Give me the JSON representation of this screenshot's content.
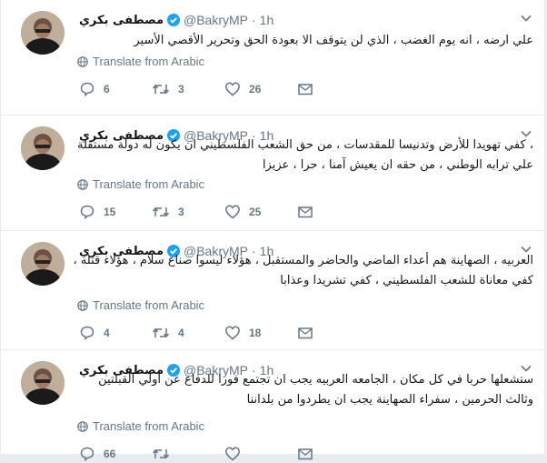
{
  "tweets": [
    {
      "display_name": "مصطفى بكري",
      "handle": "@BakryMP",
      "separator": "·",
      "time": "1h",
      "text": "علي ارضه ، انه يوم الغضب ، الذي لن يتوقف الا بعودة الحق وتحرير الأقصي الأسير",
      "translate_label": "Translate from Arabic",
      "replies": "6",
      "retweets": "3",
      "likes": "26"
    },
    {
      "display_name": "مصطفى بكري",
      "handle": "@BakryMP",
      "separator": "·",
      "time": "1h",
      "text": "، كفي تهويدا للأرض وتدنيسا للمقدسات ، من حق الشعب الفلسطيني ان يكون له دولة مستقلة علي ترابه الوطني ، من حقه ان يعيش آمنا ، حرا ، عزيزا",
      "translate_label": "Translate from Arabic",
      "replies": "15",
      "retweets": "3",
      "likes": "25"
    },
    {
      "display_name": "مصطفى بكري",
      "handle": "@BakryMP",
      "separator": "·",
      "time": "1h",
      "text": "العربيه ، الصهاينة هم أعداء الماضي والحاضر والمستقبل ، هؤلاء ليسوا صناع سلام ، هؤلاء قتله ، كفي معاناة للشعب الفلسطيني ، كفي تشريدا وعذابا",
      "translate_label": "Translate from Arabic",
      "replies": "4",
      "retweets": "4",
      "likes": "18"
    },
    {
      "display_name": "مصطفى بكري",
      "handle": "@BakryMP",
      "separator": "·",
      "time": "1h",
      "text": "ستشعلها حربا في كل مكان ، الجامعه العربيه يجب ان تجتمع فورا للدفاع عن أولي القبلتين وثالث الحرمين ، سفراء الصهاينة يجب ان يطردوا من بلداننا",
      "translate_label": "Translate from Arabic",
      "replies": "66",
      "retweets": "",
      "likes": ""
    }
  ],
  "colors": {
    "verified": "#1da1f2",
    "meta": "#657786",
    "background": "#e6ecf0"
  }
}
